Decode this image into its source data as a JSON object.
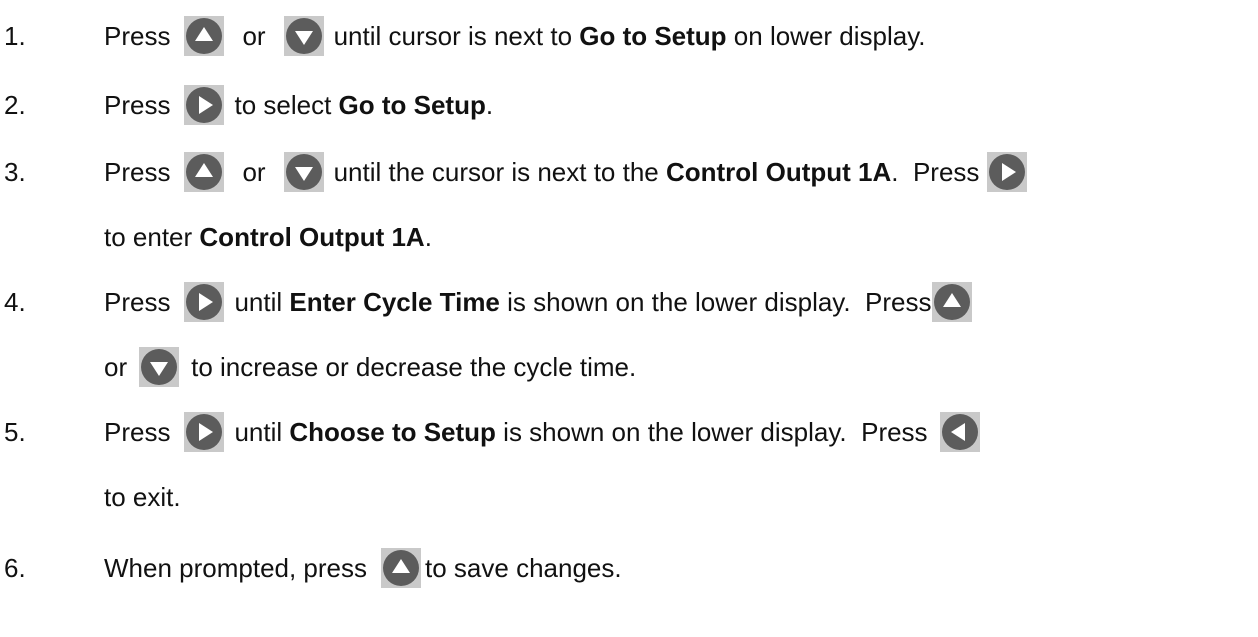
{
  "colors": {
    "button_bg": "#c9c9c9",
    "button_circle": "#5c5c5c",
    "button_arrow": "#ffffff"
  },
  "steps": [
    {
      "number": "1.",
      "press": "Press",
      "or": "or",
      "text_a": "until cursor is next to ",
      "bold_a": "Go to Setup",
      "text_b": " on lower display."
    },
    {
      "number": "2.",
      "press": "Press",
      "text_a": "to select ",
      "bold_a": "Go to Setup",
      "text_b": "."
    },
    {
      "number": "3.",
      "press": "Press",
      "or": "or",
      "text_a": "until the cursor is next to the ",
      "bold_a": "Control Output 1A",
      "text_b": ".  Press",
      "line2_a": "to enter ",
      "line2_bold": "Control Output 1A",
      "line2_b": "."
    },
    {
      "number": "4.",
      "press": "Press",
      "text_a": "until ",
      "bold_a": "Enter Cycle Time",
      "text_b": " is shown on the lower display.  Press",
      "line2_or": "or",
      "line2_a": "to increase or decrease the cycle time."
    },
    {
      "number": "5.",
      "press": "Press",
      "text_a": "until ",
      "bold_a": "Choose to Setup",
      "text_b": " is shown on the lower display.  Press",
      "line2_a": "to exit."
    },
    {
      "number": "6.",
      "press": "When prompted, press",
      "text_a": "to save changes."
    }
  ],
  "icons": [
    "up-arrow-icon",
    "down-arrow-icon",
    "right-arrow-icon",
    "left-arrow-icon"
  ]
}
